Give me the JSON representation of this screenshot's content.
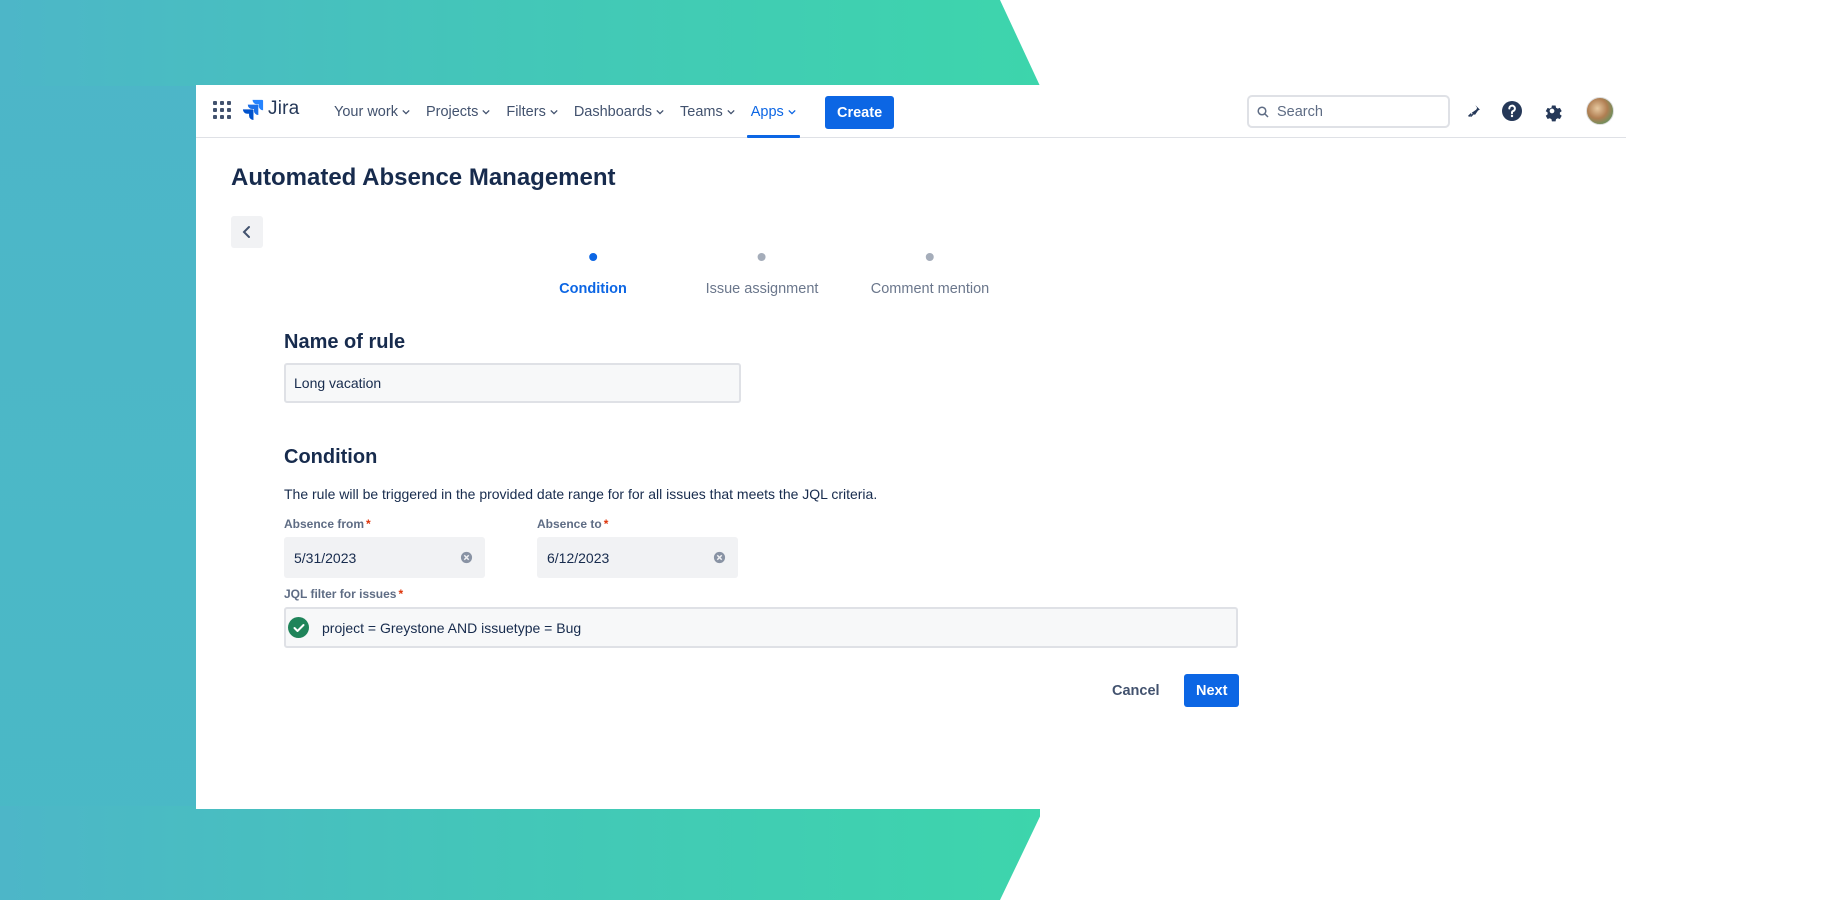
{
  "nav": {
    "logo": "Jira",
    "items": [
      {
        "label": "Your work"
      },
      {
        "label": "Projects"
      },
      {
        "label": "Filters"
      },
      {
        "label": "Dashboards"
      },
      {
        "label": "Teams"
      },
      {
        "label": "Apps",
        "active": true
      }
    ],
    "create_label": "Create",
    "search_placeholder": "Search"
  },
  "page": {
    "title": "Automated Absence Management"
  },
  "steps": [
    {
      "label": "Condition",
      "active": true
    },
    {
      "label": "Issue assignment",
      "active": false
    },
    {
      "label": "Comment mention",
      "active": false
    }
  ],
  "form": {
    "name_section_title": "Name of rule",
    "name_value": "Long vacation",
    "condition_section_title": "Condition",
    "condition_description": "The rule will be triggered in the provided date range for for all issues that meets the JQL criteria.",
    "absence_from_label": "Absence from",
    "absence_from_value": "5/31/2023",
    "absence_to_label": "Absence to",
    "absence_to_value": "6/12/2023",
    "jql_label": "JQL filter for issues",
    "jql_value": "project = Greystone AND issuetype = Bug",
    "required_marker": "*"
  },
  "actions": {
    "cancel_label": "Cancel",
    "next_label": "Next"
  },
  "colors": {
    "accent": "#0c66e4",
    "success": "#1f845a",
    "required": "#de350b"
  }
}
